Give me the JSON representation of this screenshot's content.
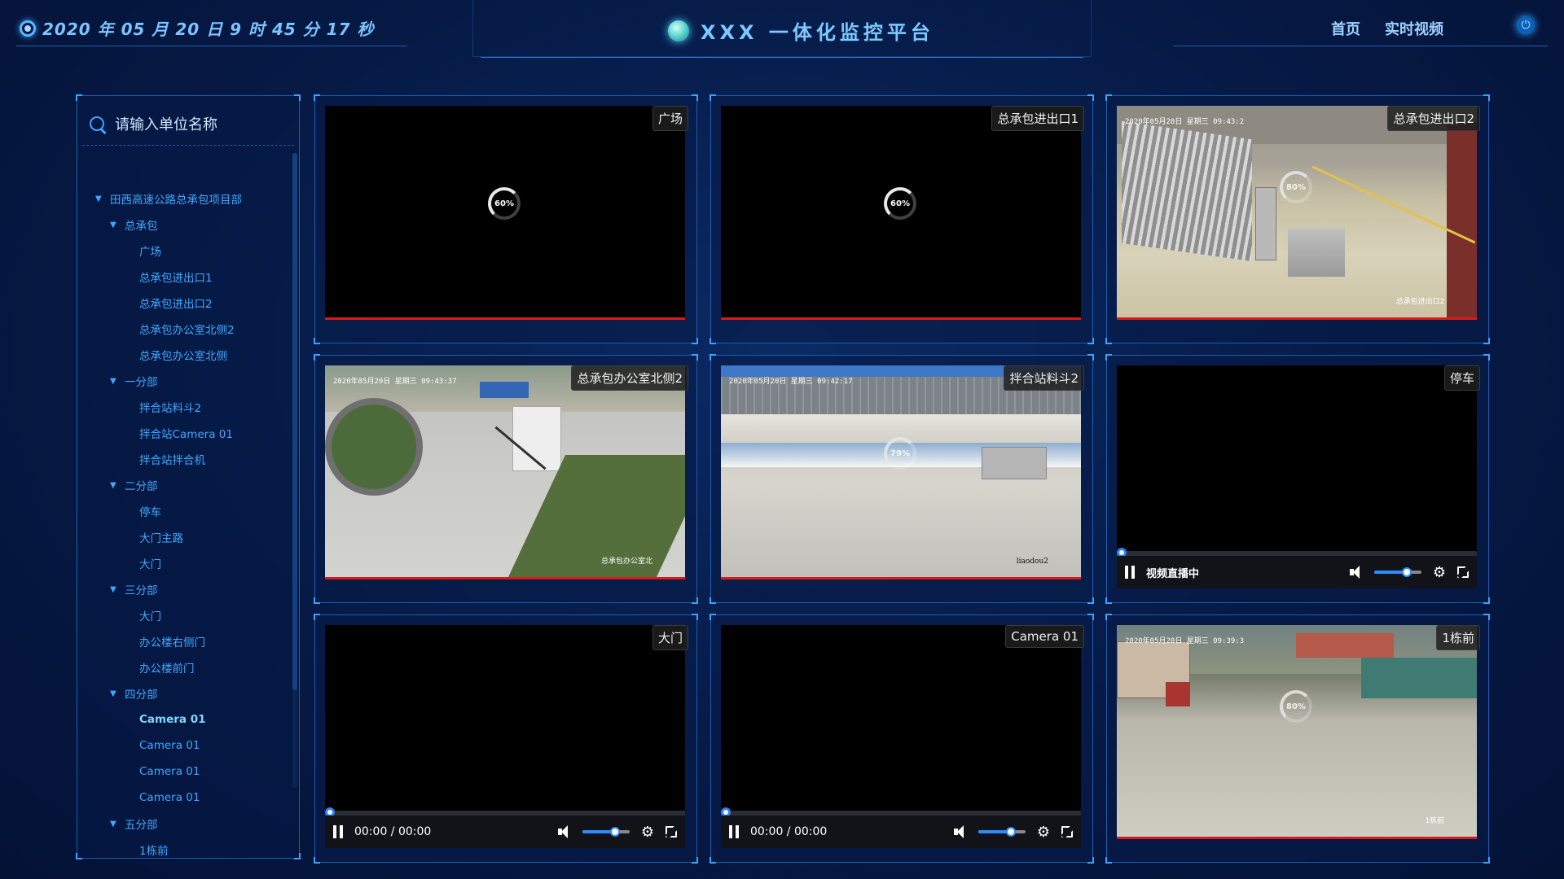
{
  "header": {
    "datetime": "2020 年 05 月 20 日 9 时 45 分 17 秒",
    "title": "XXX 一体化监控平台",
    "nav": [
      "首页",
      "实时视频"
    ]
  },
  "sidebar": {
    "search_placeholder": "请输入单位名称",
    "tree": [
      {
        "label": "田西高速公路总承包项目部",
        "level": 0,
        "expanded": true
      },
      {
        "label": "总承包",
        "level": 1,
        "expanded": true
      },
      {
        "label": "广场",
        "level": 2
      },
      {
        "label": "总承包进出口1",
        "level": 2
      },
      {
        "label": "总承包进出口2",
        "level": 2
      },
      {
        "label": "总承包办公室北侧2",
        "level": 2
      },
      {
        "label": "总承包办公室北侧",
        "level": 2
      },
      {
        "label": "一分部",
        "level": 1,
        "expanded": true
      },
      {
        "label": "拌合站料斗2",
        "level": 2
      },
      {
        "label": "拌合站Camera 01",
        "level": 2
      },
      {
        "label": "拌合站拌合机",
        "level": 2
      },
      {
        "label": "二分部",
        "level": 1,
        "expanded": true
      },
      {
        "label": "停车",
        "level": 2
      },
      {
        "label": "大门主路",
        "level": 2
      },
      {
        "label": "大门",
        "level": 2
      },
      {
        "label": "三分部",
        "level": 1,
        "expanded": true
      },
      {
        "label": "大门",
        "level": 2
      },
      {
        "label": "办公楼右侧门",
        "level": 2
      },
      {
        "label": "办公楼前门",
        "level": 2
      },
      {
        "label": "四分部",
        "level": 1,
        "expanded": true
      },
      {
        "label": "Camera 01",
        "level": 2,
        "active": true
      },
      {
        "label": "Camera 01",
        "level": 2
      },
      {
        "label": "Camera 01",
        "level": 2
      },
      {
        "label": "Camera 01",
        "level": 2
      },
      {
        "label": "五分部",
        "level": 1,
        "expanded": true
      },
      {
        "label": "1栋前",
        "level": 2
      }
    ]
  },
  "videos": [
    {
      "label": "广场",
      "state": "loading",
      "progress": "60%"
    },
    {
      "label": "总承包进出口1",
      "state": "loading",
      "progress": "60%"
    },
    {
      "label": "总承包进出口2",
      "state": "image",
      "progress": "80%",
      "osd_time": "2020年05月20日 星期三 09:43:2",
      "osd_name": "总承包进出口2"
    },
    {
      "label": "总承包办公室北侧2",
      "state": "image",
      "osd_time": "2020年05月20日 星期三 09:43:37",
      "osd_name": "总承包办公室北"
    },
    {
      "label": "拌合站料斗2",
      "state": "image",
      "progress": "79%",
      "osd_time": "2020年05月20日 星期三 09:42:17",
      "osd_name": "liaodou2"
    },
    {
      "label": "停车",
      "state": "live",
      "live_text": "视频直播中",
      "volume": 0.7
    },
    {
      "label": "大门",
      "state": "playback",
      "time": "00:00 / 00:00",
      "volume": 0.7
    },
    {
      "label": "Camera 01",
      "state": "playback",
      "time": "00:00 / 00:00",
      "volume": 0.7
    },
    {
      "label": "1栋前",
      "state": "image",
      "progress": "80%",
      "osd_time": "2020年05月20日 星期三 09:39:3",
      "osd_name": "1栋前"
    }
  ],
  "colors": {
    "accent": "#3fa9ff",
    "background": "#061a45",
    "border": "#1d5cb0",
    "red_bar": "#d81a1a"
  }
}
